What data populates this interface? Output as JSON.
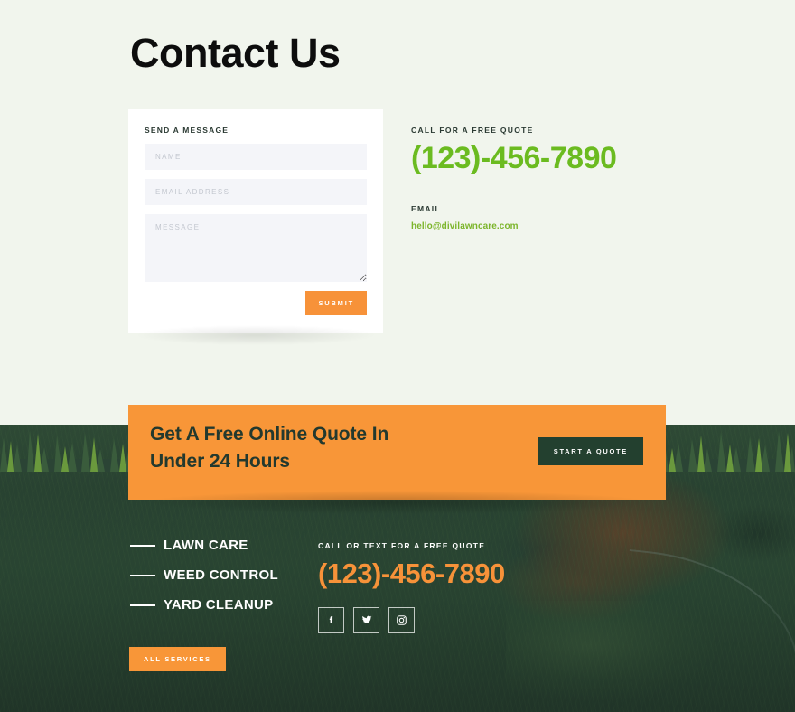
{
  "page": {
    "title": "Contact Us",
    "background_color": "#f1f5ed"
  },
  "colors": {
    "accent_orange": "#f89638",
    "accent_green": "#6bbb20",
    "link_green": "#7cb52b",
    "dark_green": "#23402f",
    "page_bg": "#f1f5ed",
    "card_bg": "#ffffff",
    "field_bg": "#f4f5f9"
  },
  "form": {
    "heading": "SEND A MESSAGE",
    "name_placeholder": "NAME",
    "name_value": "",
    "email_placeholder": "EMAIL ADDRESS",
    "email_value": "",
    "message_placeholder": "MESSAGE",
    "message_value": "",
    "submit_label": "SUBMIT"
  },
  "contact": {
    "phone_eyebrow": "CALL FOR A FREE QUOTE",
    "phone": "(123)-456-7890",
    "email_eyebrow": "EMAIL",
    "email": "hello@divilawncare.com"
  },
  "cta": {
    "heading_line1": "Get A Free Online Quote In",
    "heading_line2": "Under 24 Hours",
    "button_label": "START A QUOTE"
  },
  "footer": {
    "services": [
      {
        "label": "LAWN CARE"
      },
      {
        "label": "WEED CONTROL"
      },
      {
        "label": "YARD CLEANUP"
      }
    ],
    "all_services_label": "ALL SERVICES",
    "phone_eyebrow": "CALL OR TEXT FOR A FREE QUOTE",
    "phone": "(123)-456-7890",
    "social": [
      {
        "name": "facebook-icon",
        "label": "f"
      },
      {
        "name": "twitter-icon",
        "label": "t"
      },
      {
        "name": "instagram-icon",
        "label": "i"
      }
    ]
  }
}
